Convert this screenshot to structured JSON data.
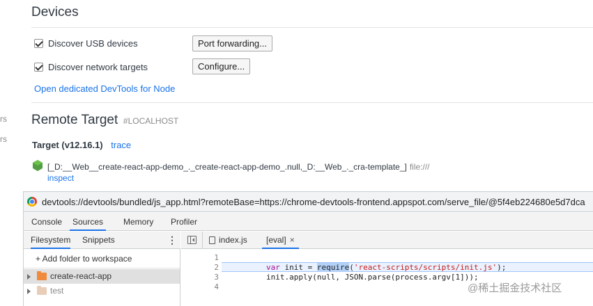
{
  "left_clip": {
    "line1": "rs",
    "line2": "rs"
  },
  "devices": {
    "title": "Devices",
    "usb": {
      "label": "Discover USB devices",
      "checked": true,
      "button": "Port forwarding..."
    },
    "network": {
      "label": "Discover network targets",
      "checked": true,
      "button": "Configure..."
    },
    "node_link": "Open dedicated DevTools for Node"
  },
  "remote": {
    "title": "Remote Target",
    "subtitle": "#LOCALHOST",
    "target_heading": "Target (v12.16.1)",
    "trace_link": "trace",
    "target_name": "[_D:__Web__create-react-app-demo_._create-react-app-demo_.null,_D:__Web_._cra-template_]",
    "target_url": "file:///",
    "inspect_link": "inspect"
  },
  "devtools": {
    "url": "devtools://devtools/bundled/js_app.html?remoteBase=https://chrome-devtools-frontend.appspot.com/serve_file/@5f4eb224680e5d7dca",
    "tabs": [
      "Console",
      "Sources",
      "Memory",
      "Profiler"
    ],
    "active_tab": "Sources",
    "sidebar": {
      "subtabs": [
        "Filesystem",
        "Snippets"
      ],
      "kebab": "⋮",
      "add_folder": "+ Add folder to workspace",
      "folders": [
        {
          "name": "create-react-app",
          "color": "#f08a3c"
        },
        {
          "name": "test",
          "color": "#e8cdb8"
        }
      ]
    },
    "editor": {
      "tabs": [
        {
          "label": "index.js"
        },
        {
          "label": "[eval]",
          "close": "×"
        }
      ],
      "line_numbers": [
        "1",
        "2",
        "3",
        "4"
      ],
      "code": {
        "l2_kw": "var",
        "l2_a": " init = ",
        "l2_sel": "require",
        "l2_b": "(",
        "l2_str": "'react-scripts/scripts/init.js'",
        "l2_c": ");",
        "l3": "init.apply(null, JSON.parse(process.argv[1]));"
      }
    }
  },
  "watermark": "@稀土掘金技术社区",
  "colors": {
    "link": "#1a73e8",
    "active_tab_underline": "#1a73e8",
    "node_green": "#539e43"
  }
}
